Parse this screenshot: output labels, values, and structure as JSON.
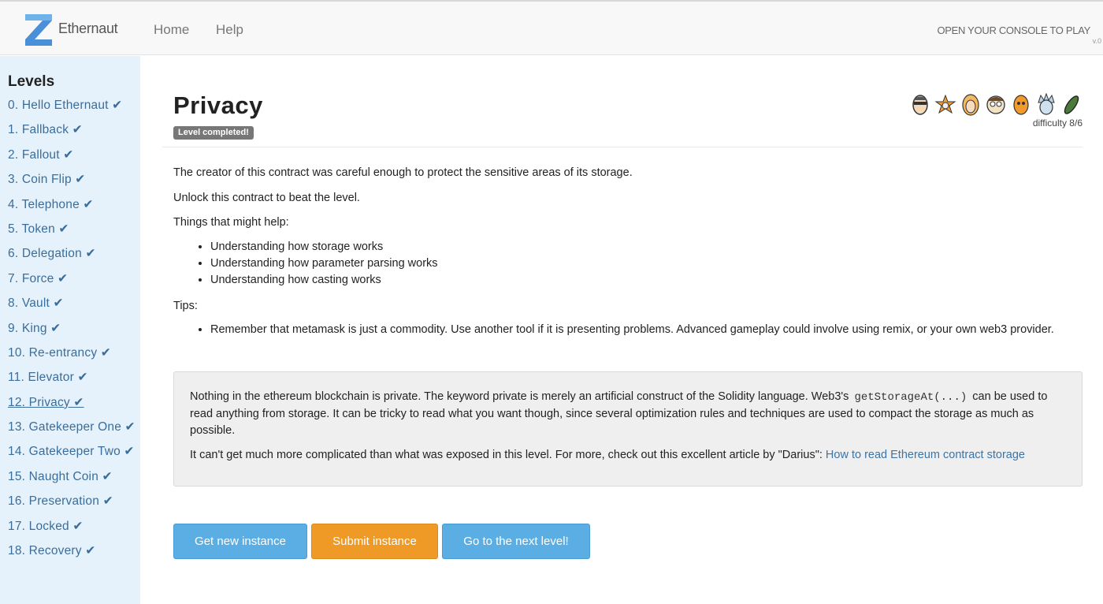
{
  "nav": {
    "brand": "Ethernaut",
    "home": "Home",
    "help": "Help",
    "console_text": "OPEN YOUR CONSOLE TO PLAY",
    "version": "v.0"
  },
  "sidebar": {
    "title": "Levels",
    "items": [
      {
        "label": "0. Hello Ethernaut ✔"
      },
      {
        "label": "1. Fallback ✔"
      },
      {
        "label": "2. Fallout ✔"
      },
      {
        "label": "3. Coin Flip ✔"
      },
      {
        "label": "4. Telephone ✔"
      },
      {
        "label": "5. Token ✔"
      },
      {
        "label": "6. Delegation ✔"
      },
      {
        "label": "7. Force ✔"
      },
      {
        "label": "8. Vault ✔"
      },
      {
        "label": "9. King ✔"
      },
      {
        "label": "10. Re-entrancy ✔"
      },
      {
        "label": "11. Elevator ✔"
      },
      {
        "label": "12. Privacy ✔"
      },
      {
        "label": "13. Gatekeeper One ✔"
      },
      {
        "label": "14. Gatekeeper Two ✔"
      },
      {
        "label": "15. Naught Coin ✔"
      },
      {
        "label": "16. Preservation ✔"
      },
      {
        "label": "17. Locked ✔"
      },
      {
        "label": "18. Recovery ✔"
      }
    ],
    "active_index": 12
  },
  "level": {
    "title": "Privacy",
    "badge": "Level completed!",
    "difficulty": "difficulty 8/6",
    "avatars": [
      "face-icon",
      "star-face-icon",
      "blonde-face-icon",
      "glasses-face-icon",
      "orange-face-icon",
      "spiky-face-icon",
      "pickle-icon"
    ]
  },
  "description": {
    "p1": "The creator of this contract was careful enough to protect the sensitive areas of its storage.",
    "p2": "Unlock this contract to beat the level.",
    "p3": "Things that might help:",
    "helps": [
      "Understanding how storage works",
      "Understanding how parameter parsing works",
      "Understanding how casting works"
    ],
    "tips_title": "Tips:",
    "tips": [
      "Remember that metamask is just a commodity. Use another tool if it is presenting problems. Advanced gameplay could involve using remix, or your own web3 provider."
    ]
  },
  "note": {
    "p1_before": "Nothing in the ethereum blockchain is private. The keyword private is merely an artificial construct of the Solidity language. Web3's ",
    "p1_code": "getStorageAt(...)",
    "p1_after": " can be used to read anything from storage. It can be tricky to read what you want though, since several optimization rules and techniques are used to compact the storage as much as possible.",
    "p2_before": "It can't get much more complicated than what was exposed in this level. For more, check out this excellent article by \"Darius\": ",
    "p2_link": "How to read Ethereum contract storage"
  },
  "buttons": {
    "new_instance": "Get new instance",
    "submit": "Submit instance",
    "next": "Go to the next level!"
  },
  "colors": {
    "sidebar_bg": "#e6f2fb",
    "link": "#3c74a6",
    "btn_blue": "#5aaee3",
    "btn_orange": "#ef9a27",
    "badge": "#777777"
  }
}
